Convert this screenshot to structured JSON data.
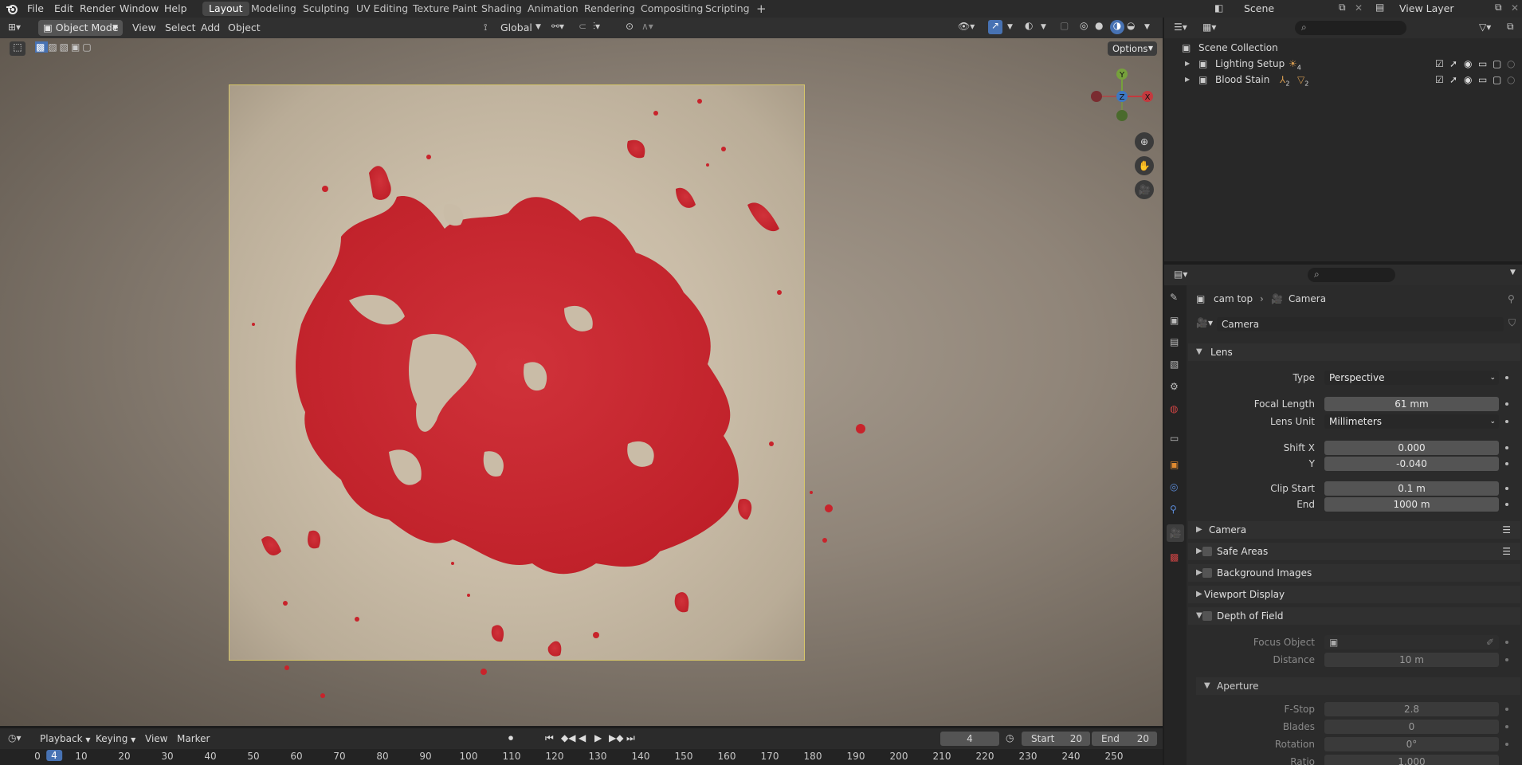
{
  "topbar": {
    "menus": [
      "File",
      "Edit",
      "Render",
      "Window",
      "Help"
    ],
    "workspaces": [
      "Layout",
      "Modeling",
      "Sculpting",
      "UV Editing",
      "Texture Paint",
      "Shading",
      "Animation",
      "Rendering",
      "Compositing",
      "Scripting"
    ],
    "active_workspace": "Layout",
    "scene_label": "Scene",
    "view_layer_label": "View Layer"
  },
  "viewport_header": {
    "mode": "Object Mode",
    "menus": [
      "View",
      "Select",
      "Add",
      "Object"
    ],
    "orientation": "Global",
    "options_label": "Options"
  },
  "gizmo": {
    "x": "X",
    "y": "Y",
    "z": "Z"
  },
  "outliner": {
    "root": "Scene Collection",
    "items": [
      {
        "name": "Lighting Setup",
        "badge": "4"
      },
      {
        "name": "Blood Stain",
        "badge1": "2",
        "badge2": "2"
      }
    ]
  },
  "properties": {
    "breadcrumb_object": "cam top",
    "breadcrumb_data": "Camera",
    "datablock_name": "Camera",
    "lens_section": "Lens",
    "type_label": "Type",
    "type_value": "Perspective",
    "focal_label": "Focal Length",
    "focal_value": "61 mm",
    "lens_unit_label": "Lens Unit",
    "lens_unit_value": "Millimeters",
    "shift_x_label": "Shift X",
    "shift_x_value": "0.000",
    "shift_y_label": "Y",
    "shift_y_value": "-0.040",
    "clip_start_label": "Clip Start",
    "clip_start_value": "0.1 m",
    "clip_end_label": "End",
    "clip_end_value": "1000 m",
    "sections": [
      "Camera",
      "Safe Areas",
      "Background Images",
      "Viewport Display",
      "Depth of Field"
    ],
    "focus_object_label": "Focus Object",
    "distance_label": "Distance",
    "distance_value": "10 m",
    "aperture_section": "Aperture",
    "fstop_label": "F-Stop",
    "fstop_value": "2.8",
    "blades_label": "Blades",
    "blades_value": "0",
    "rotation_label": "Rotation",
    "rotation_value": "0°",
    "ratio_label": "Ratio",
    "ratio_value": "1.000"
  },
  "timeline": {
    "menus": [
      "Playback",
      "Keying",
      "View",
      "Marker"
    ],
    "current_frame": "4",
    "start_label": "Start",
    "start_value": "20",
    "end_label": "End",
    "end_value": "20",
    "ruler": [
      "0",
      "4",
      "10",
      "20",
      "30",
      "40",
      "50",
      "60",
      "70",
      "80",
      "90",
      "100",
      "110",
      "120",
      "130",
      "140",
      "150",
      "160",
      "170",
      "180",
      "190",
      "200",
      "210",
      "220",
      "230",
      "240",
      "250"
    ]
  },
  "colors": {
    "blood": "#c8232b",
    "frame": "#d7c76a",
    "accent": "#4772b3"
  }
}
